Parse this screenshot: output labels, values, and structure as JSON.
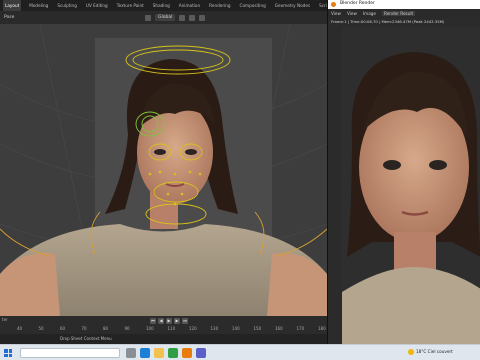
{
  "workspace_tabs": [
    "Layout",
    "Modeling",
    "Sculpting",
    "UV Editing",
    "Texture Paint",
    "Shading",
    "Animation",
    "Rendering",
    "Compositing",
    "Geometry Nodes",
    "Scripting"
  ],
  "active_tab": "Layout",
  "header": {
    "mode": "Pose",
    "orientation": "Global"
  },
  "timeline": {
    "ticks": [
      "40",
      "50",
      "60",
      "70",
      "80",
      "90",
      "100",
      "110",
      "120",
      "130",
      "140",
      "150",
      "160",
      "170",
      "180"
    ],
    "current_frame_label": "ter"
  },
  "status_bar": {
    "text": "Drop Sheet Context Menu"
  },
  "render_window": {
    "title": "Blender Render",
    "menu": [
      "View",
      "View",
      "Image"
    ],
    "slot": "Render Result",
    "info": "Frame:1 | Time:00:06.70 | Mem:2346.47M (Peak 2443.35M)"
  },
  "taskbar": {
    "weather_text": "18°C  Ciel couvert"
  },
  "colors": {
    "rig_yellow": "#d6c21a",
    "rig_green": "#7fc33a",
    "rig_orange": "#d9a030",
    "blender_orange": "#e87d0d"
  }
}
